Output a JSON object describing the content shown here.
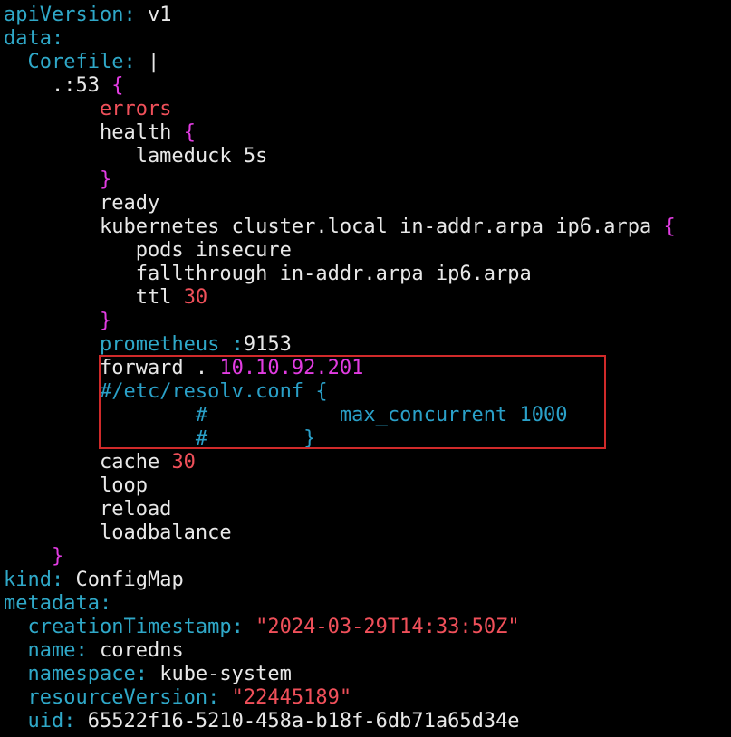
{
  "editor": {
    "lines": [
      {
        "tokens": [
          {
            "t": "apiVersion:",
            "c": "key"
          },
          {
            "t": " v1",
            "c": "plain"
          }
        ]
      },
      {
        "tokens": [
          {
            "t": "data:",
            "c": "key"
          }
        ]
      },
      {
        "tokens": [
          {
            "t": "  ",
            "c": "plain"
          },
          {
            "t": "Corefile:",
            "c": "key"
          },
          {
            "t": " |",
            "c": "plain"
          }
        ]
      },
      {
        "tokens": [
          {
            "t": "    .:53 ",
            "c": "plain"
          },
          {
            "t": "{",
            "c": "magenta"
          }
        ]
      },
      {
        "tokens": [
          {
            "t": "        ",
            "c": "plain"
          },
          {
            "t": "errors",
            "c": "red"
          }
        ]
      },
      {
        "tokens": [
          {
            "t": "        health ",
            "c": "plain"
          },
          {
            "t": "{",
            "c": "magenta"
          }
        ]
      },
      {
        "tokens": [
          {
            "t": "           lameduck 5s",
            "c": "plain"
          }
        ]
      },
      {
        "tokens": [
          {
            "t": "        ",
            "c": "plain"
          },
          {
            "t": "}",
            "c": "magenta"
          }
        ]
      },
      {
        "tokens": [
          {
            "t": "        ready",
            "c": "plain"
          }
        ]
      },
      {
        "tokens": [
          {
            "t": "        kubernetes cluster.local in-addr.arpa ip6.arpa ",
            "c": "plain"
          },
          {
            "t": "{",
            "c": "magenta"
          }
        ]
      },
      {
        "tokens": [
          {
            "t": "           pods insecure",
            "c": "plain"
          }
        ]
      },
      {
        "tokens": [
          {
            "t": "           fallthrough in-addr.arpa ip6.arpa",
            "c": "plain"
          }
        ]
      },
      {
        "tokens": [
          {
            "t": "           ttl ",
            "c": "plain"
          },
          {
            "t": "30",
            "c": "red"
          }
        ]
      },
      {
        "tokens": [
          {
            "t": "        ",
            "c": "plain"
          },
          {
            "t": "}",
            "c": "magenta"
          }
        ]
      },
      {
        "tokens": [
          {
            "t": "        ",
            "c": "plain"
          },
          {
            "t": "prometheus",
            "c": "key"
          },
          {
            "t": " ",
            "c": "plain"
          },
          {
            "t": ":",
            "c": "key"
          },
          {
            "t": "9153",
            "c": "plain"
          }
        ]
      },
      {
        "tokens": [
          {
            "t": "        forward . ",
            "c": "plain"
          },
          {
            "t": "10.10.92.201",
            "c": "magenta"
          }
        ]
      },
      {
        "tokens": [
          {
            "t": "        ",
            "c": "plain"
          },
          {
            "t": "#/etc/resolv.conf {",
            "c": "comment"
          }
        ]
      },
      {
        "tokens": [
          {
            "t": "                ",
            "c": "plain"
          },
          {
            "t": "#           max_concurrent 1000",
            "c": "comment"
          }
        ]
      },
      {
        "tokens": [
          {
            "t": "                ",
            "c": "plain"
          },
          {
            "t": "#        }",
            "c": "comment"
          }
        ]
      },
      {
        "tokens": [
          {
            "t": "        cache ",
            "c": "plain"
          },
          {
            "t": "30",
            "c": "red"
          }
        ]
      },
      {
        "tokens": [
          {
            "t": "        loop",
            "c": "plain"
          }
        ]
      },
      {
        "tokens": [
          {
            "t": "        reload",
            "c": "plain"
          }
        ]
      },
      {
        "tokens": [
          {
            "t": "        loadbalance",
            "c": "plain"
          }
        ]
      },
      {
        "tokens": [
          {
            "t": "    ",
            "c": "plain"
          },
          {
            "t": "}",
            "c": "magenta"
          }
        ]
      },
      {
        "tokens": [
          {
            "t": "kind:",
            "c": "key"
          },
          {
            "t": " ConfigMap",
            "c": "plain"
          }
        ]
      },
      {
        "tokens": [
          {
            "t": "metadata:",
            "c": "key"
          }
        ]
      },
      {
        "tokens": [
          {
            "t": "  ",
            "c": "plain"
          },
          {
            "t": "creationTimestamp:",
            "c": "key"
          },
          {
            "t": " ",
            "c": "plain"
          },
          {
            "t": "\"2024-03-29T14:33:50Z\"",
            "c": "string"
          }
        ]
      },
      {
        "tokens": [
          {
            "t": "  ",
            "c": "plain"
          },
          {
            "t": "name:",
            "c": "key"
          },
          {
            "t": " coredns",
            "c": "plain"
          }
        ]
      },
      {
        "tokens": [
          {
            "t": "  ",
            "c": "plain"
          },
          {
            "t": "namespace:",
            "c": "key"
          },
          {
            "t": " kube-system",
            "c": "plain"
          }
        ]
      },
      {
        "tokens": [
          {
            "t": "  ",
            "c": "plain"
          },
          {
            "t": "resourceVersion:",
            "c": "key"
          },
          {
            "t": " ",
            "c": "plain"
          },
          {
            "t": "\"22445189\"",
            "c": "string"
          }
        ]
      },
      {
        "tokens": [
          {
            "t": "  ",
            "c": "plain"
          },
          {
            "t": "uid:",
            "c": "key"
          },
          {
            "t": " 65522f16-5210-458a-b18f-6db71a65d34e",
            "c": "plain"
          }
        ]
      }
    ]
  },
  "colors": {
    "background": "#000000",
    "key": "#2fa8c8",
    "plain": "#e8e8e8",
    "red": "#f0505a",
    "magenta": "#e23ce2",
    "comment": "#2aa0c8",
    "highlight_border": "#d02a2a"
  }
}
